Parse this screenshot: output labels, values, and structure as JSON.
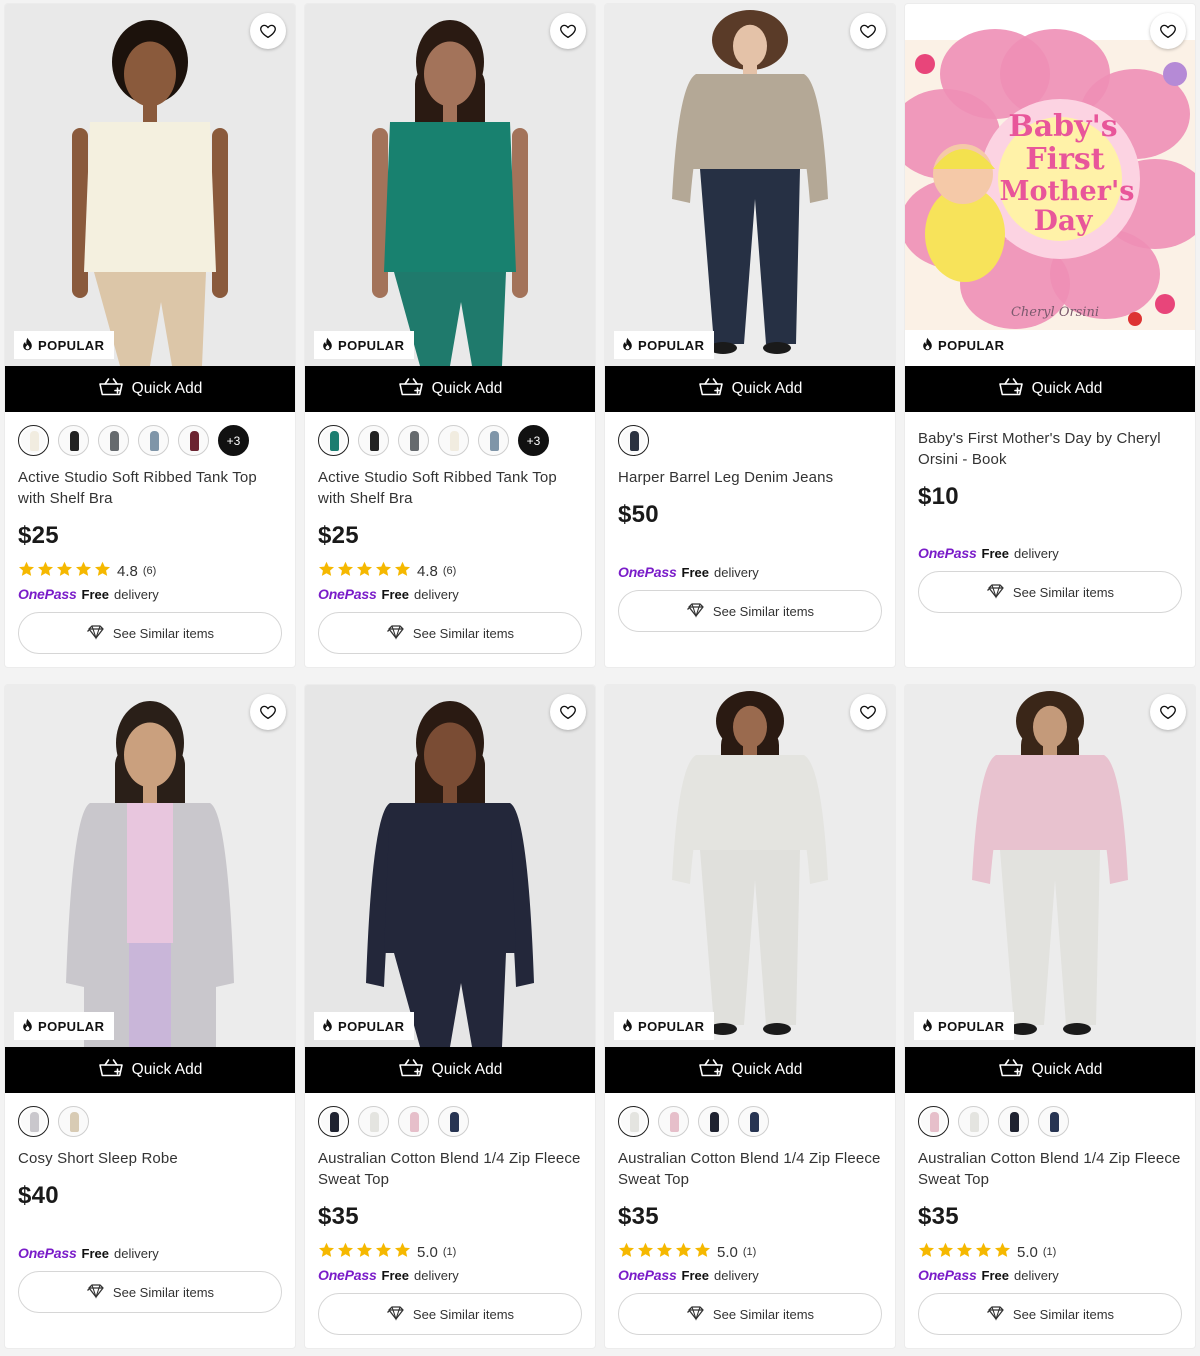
{
  "common": {
    "popular_label": "POPULAR",
    "quick_add_label": "Quick Add",
    "onepass_brand": "OnePass",
    "onepass_free": "Free",
    "onepass_delivery": "delivery",
    "see_similar_label": "See Similar items"
  },
  "colors": {
    "onepass": "#7a1cc9",
    "star": "#f5b800",
    "quick_add_bg": "#000000"
  },
  "products": [
    {
      "title": "Active Studio Soft Ribbed Tank Top with Shelf Bra",
      "price": "$25",
      "rating": "4.8",
      "review_count": "(6)",
      "swatches": [
        "#f1ece0",
        "#222222",
        "#666a6e",
        "#7f95a8",
        "#6b2330"
      ],
      "more_swatches": "+3",
      "image": "woman-cream-tank-top"
    },
    {
      "title": "Active Studio Soft Ribbed Tank Top with Shelf Bra",
      "price": "$25",
      "rating": "4.8",
      "review_count": "(6)",
      "swatches": [
        "#1b7d70",
        "#222222",
        "#666a6e",
        "#f1ece0",
        "#7f95a8"
      ],
      "more_swatches": "+3",
      "image": "woman-teal-tank-top"
    },
    {
      "title": "Harper Barrel Leg Denim Jeans",
      "price": "$50",
      "rating": "",
      "review_count": "",
      "swatches": [
        "#2b3240"
      ],
      "more_swatches": "",
      "image": "woman-denim-jeans"
    },
    {
      "title": "Baby's First Mother's Day by Cheryl Orsini - Book",
      "price": "$10",
      "rating": "",
      "review_count": "",
      "swatches": [],
      "more_swatches": "",
      "image": "book-cover",
      "book": {
        "line1": "Baby's",
        "line2": "First",
        "line3": "Mother's",
        "line4": "Day",
        "author": "Cheryl Orsini"
      }
    },
    {
      "title": "Cosy Short Sleep Robe",
      "price": "$40",
      "rating": "",
      "review_count": "",
      "swatches": [
        "#c9c7cc",
        "#d8cbb4"
      ],
      "more_swatches": "",
      "image": "woman-grey-robe"
    },
    {
      "title": "Australian Cotton Blend 1/4 Zip Fleece Sweat Top",
      "price": "$35",
      "rating": "5.0",
      "review_count": "(1)",
      "swatches": [
        "#1f2230",
        "#e4e4e0",
        "#e6bfca",
        "#273452"
      ],
      "more_swatches": "",
      "image": "woman-navy-sweat-top"
    },
    {
      "title": "Australian Cotton Blend 1/4 Zip Fleece Sweat Top",
      "price": "$35",
      "rating": "5.0",
      "review_count": "(1)",
      "swatches": [
        "#e4e4e0",
        "#e6bfca",
        "#1f2230",
        "#273452"
      ],
      "more_swatches": "",
      "image": "woman-grey-sweat-top"
    },
    {
      "title": "Australian Cotton Blend 1/4 Zip Fleece Sweat Top",
      "price": "$35",
      "rating": "5.0",
      "review_count": "(1)",
      "swatches": [
        "#e6bfca",
        "#e4e4e0",
        "#1f2230",
        "#273452"
      ],
      "more_swatches": "",
      "image": "woman-pink-sweat-top"
    }
  ]
}
